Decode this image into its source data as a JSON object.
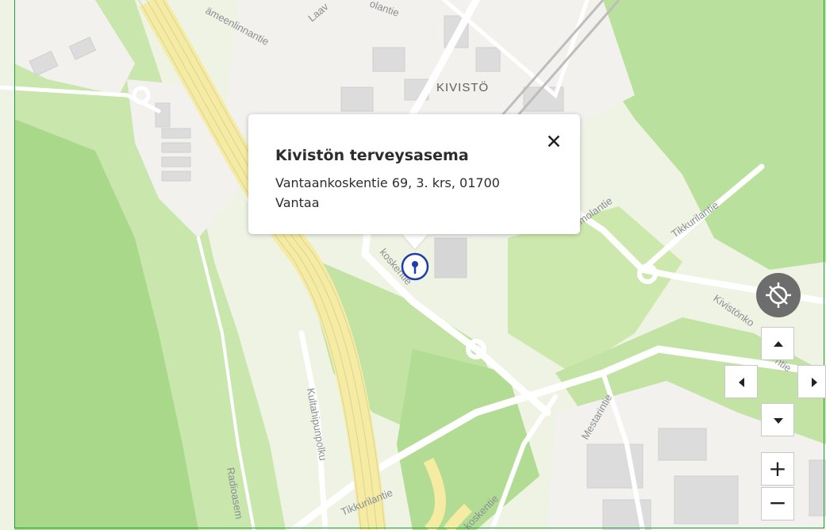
{
  "map": {
    "district_label": "KIVISTÖ",
    "street_labels": {
      "hameenlinnantie": "ämeenlinnantie",
      "laavatie": "Laav",
      "kolantie": "olantie",
      "tikkurilantie_ne": "Tikkurilantie",
      "kivistonkoskentie": "Kivistönko",
      "kivistonkoskentie_end": "ntie",
      "koskentie_marker": "koskentie",
      "mestarintie": "Mestarintie",
      "kultahipunpolku": "Kultahipunpolku",
      "radioasema": "Radioasem",
      "tikkurilantie_sw": "Tikkurilantie",
      "koskentie_bottom": "koskentie",
      "imolantie": "imolantie"
    },
    "colors": {
      "land": "#f4f3ef",
      "park": "#cfeab0",
      "forest": "#b9e09c",
      "motorway": "#f7eda6",
      "road": "#ffffff",
      "building": "#dcdcdc",
      "marker": "#1e3ea8"
    }
  },
  "popup": {
    "title": "Kivistön terveysasema",
    "address": "Vantaankoskentie 69, 3. krs, 01700 Vantaa",
    "close_icon": "✕"
  },
  "controls": {
    "locate_icon": "gps-off-icon",
    "pan_up": "pan-up-icon",
    "pan_left": "pan-left-icon",
    "pan_right": "pan-right-icon",
    "pan_down": "pan-down-icon",
    "zoom_in_label": "+",
    "zoom_out_label": "−"
  }
}
